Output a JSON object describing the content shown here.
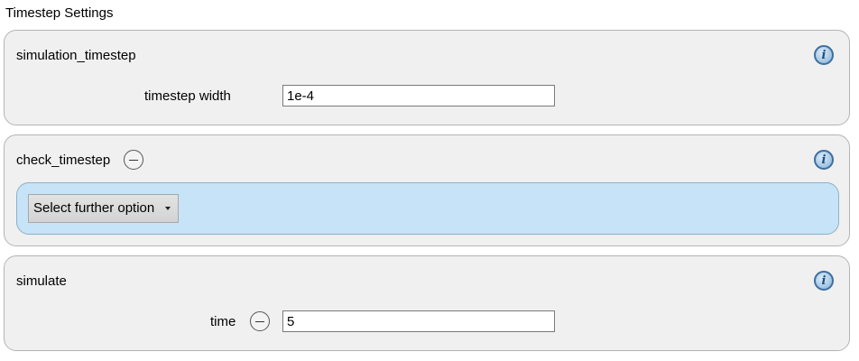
{
  "window": {
    "title": "Timestep Settings"
  },
  "groups": [
    {
      "title": "simulation_timestep",
      "field": {
        "label": "timestep width",
        "value": "1e-4"
      }
    },
    {
      "title": "check_timestep",
      "option_select": {
        "label": "Select further option"
      }
    },
    {
      "title": "simulate",
      "field": {
        "label": "time",
        "value": "5"
      }
    }
  ],
  "icons": {
    "info": "info-icon",
    "remove": "minus-circle-icon",
    "dropdown": "caret-down-icon"
  },
  "colors": {
    "group_background": "#f0f0f0",
    "option_panel_background": "#c6e3f7",
    "info_icon_blue": "#3e6f9e"
  }
}
